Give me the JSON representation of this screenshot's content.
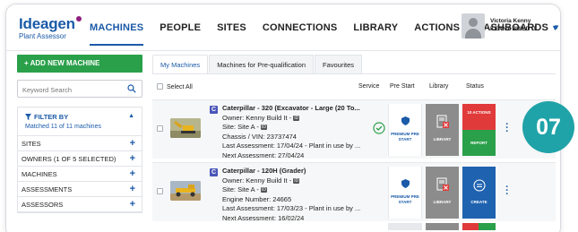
{
  "header": {
    "logo_brand": "Ideagen",
    "logo_sub": "Plant Assessor",
    "nav": [
      {
        "label": "MACHINES",
        "active": true
      },
      {
        "label": "PEOPLE"
      },
      {
        "label": "SITES"
      },
      {
        "label": "CONNECTIONS"
      },
      {
        "label": "LIBRARY"
      },
      {
        "label": "ACTIONS"
      },
      {
        "label": "DASHBOARDS"
      }
    ],
    "user_name": "Victoria Kenny",
    "user_org": "KENNY BUILD IT"
  },
  "sidebar": {
    "add_button": "+ ADD NEW MACHINE",
    "search_placeholder": "Keyword Search",
    "filter_title": "FILTER BY",
    "filter_sub": "Matched 11 of 11 machines",
    "filters": [
      "SITES",
      "OWNERS (1 OF 5 SELECTED)",
      "MACHINES",
      "ASSESSMENTS",
      "ASSESSORS"
    ]
  },
  "tabs": [
    "My Machines",
    "Machines for Pre-qualification",
    "Favourites"
  ],
  "table_headers": {
    "select_all": "Select All",
    "service": "Service",
    "pre_start": "Pre Start",
    "library": "Library",
    "status": "Status"
  },
  "rows": [
    {
      "category": "C",
      "title": "Caterpillar - 320 (Excavator - Large (20 To...",
      "owner": "Owner: Kenny Build It -",
      "site": "Site: Site A -",
      "id_line": "Chassis / VIN: 23737474",
      "last": "Last Assessment: 17/04/24 - Plant in use by ...",
      "next": "Next Assessment: 27/04/24",
      "prestart_label": "PREMIUM PRE START",
      "library_label": "LIBRARY",
      "status_top": "10 ACTIONS",
      "status_bottom": "REPORT"
    },
    {
      "category": "C",
      "title": "Caterpillar - 120H (Grader)",
      "owner": "Owner: Kenny Build It -",
      "site": "Site: Site A -",
      "id_line": "Engine Number: 24665",
      "last": "Last Assessment: 17/03/23 - Plant in use by ...",
      "next": "Next Assessment: 16/02/24",
      "prestart_label": "PREMIUM PRE START",
      "library_label": "LIBRARY",
      "status_create": "CREATE"
    }
  ],
  "step_badge": "07",
  "colors": {
    "brand_blue": "#1a5aa8",
    "green": "#2aa04a",
    "red": "#e03a3a",
    "teal": "#20a3a8",
    "library_gray": "#8c8c8c",
    "create_blue": "#1f62b0"
  }
}
